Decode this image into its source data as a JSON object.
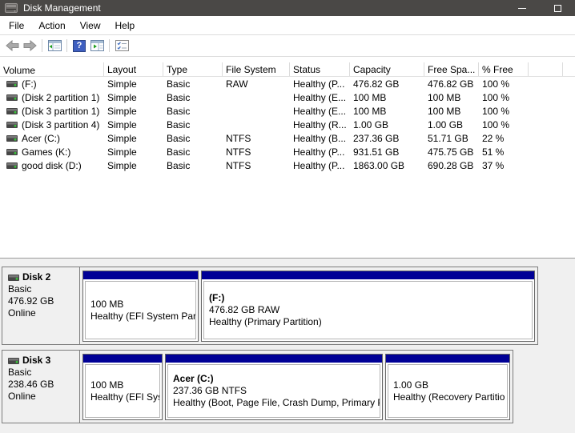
{
  "window": {
    "title": "Disk Management"
  },
  "menu": {
    "items": [
      "File",
      "Action",
      "View",
      "Help"
    ]
  },
  "toolbar": {
    "buttons": [
      "back",
      "forward",
      "show-console-tree",
      "help",
      "show-action-pane",
      "checklist"
    ]
  },
  "volume_list": {
    "columns": [
      "Volume",
      "Layout",
      "Type",
      "File System",
      "Status",
      "Capacity",
      "Free Spa...",
      "% Free"
    ],
    "rows": [
      {
        "volume": "(F:)",
        "layout": "Simple",
        "type": "Basic",
        "file_system": "RAW",
        "status": "Healthy (P...",
        "capacity": "476.82 GB",
        "free_space": "476.82 GB",
        "percent_free": "100 %"
      },
      {
        "volume": "(Disk 2 partition 1)",
        "layout": "Simple",
        "type": "Basic",
        "file_system": "",
        "status": "Healthy (E...",
        "capacity": "100 MB",
        "free_space": "100 MB",
        "percent_free": "100 %"
      },
      {
        "volume": "(Disk 3 partition 1)",
        "layout": "Simple",
        "type": "Basic",
        "file_system": "",
        "status": "Healthy (E...",
        "capacity": "100 MB",
        "free_space": "100 MB",
        "percent_free": "100 %"
      },
      {
        "volume": "(Disk 3 partition 4)",
        "layout": "Simple",
        "type": "Basic",
        "file_system": "",
        "status": "Healthy (R...",
        "capacity": "1.00 GB",
        "free_space": "1.00 GB",
        "percent_free": "100 %"
      },
      {
        "volume": "Acer (C:)",
        "layout": "Simple",
        "type": "Basic",
        "file_system": "NTFS",
        "status": "Healthy (B...",
        "capacity": "237.36 GB",
        "free_space": "51.71 GB",
        "percent_free": "22 %"
      },
      {
        "volume": "Games (K:)",
        "layout": "Simple",
        "type": "Basic",
        "file_system": "NTFS",
        "status": "Healthy (P...",
        "capacity": "931.51 GB",
        "free_space": "475.75 GB",
        "percent_free": "51 %"
      },
      {
        "volume": "good disk (D:)",
        "layout": "Simple",
        "type": "Basic",
        "file_system": "NTFS",
        "status": "Healthy (P...",
        "capacity": "1863.00 GB",
        "free_space": "690.28 GB",
        "percent_free": "37 %"
      }
    ]
  },
  "graphical_view": {
    "disks": [
      {
        "label": "Disk 2",
        "type": "Basic",
        "size": "476.92 GB",
        "status": "Online",
        "partitions": [
          {
            "name": "",
            "size": "100 MB",
            "status": "Healthy (EFI System Parti"
          },
          {
            "name": "(F:)",
            "size": "476.82 GB RAW",
            "status": "Healthy (Primary Partition)"
          }
        ]
      },
      {
        "label": "Disk 3",
        "type": "Basic",
        "size": "238.46 GB",
        "status": "Online",
        "partitions": [
          {
            "name": "",
            "size": "100 MB",
            "status": "Healthy (EFI Syst"
          },
          {
            "name": "Acer  (C:)",
            "size": "237.36 GB NTFS",
            "status": "Healthy (Boot, Page File, Crash Dump, Primary Pa"
          },
          {
            "name": "",
            "size": "1.00 GB",
            "status": "Healthy (Recovery Partitio"
          }
        ]
      }
    ]
  },
  "colors": {
    "titlebar": "#4a4846",
    "partition_bar": "#000096",
    "drive_led_green": "#39c339",
    "help_icon_blue": "#3f5fc0"
  }
}
